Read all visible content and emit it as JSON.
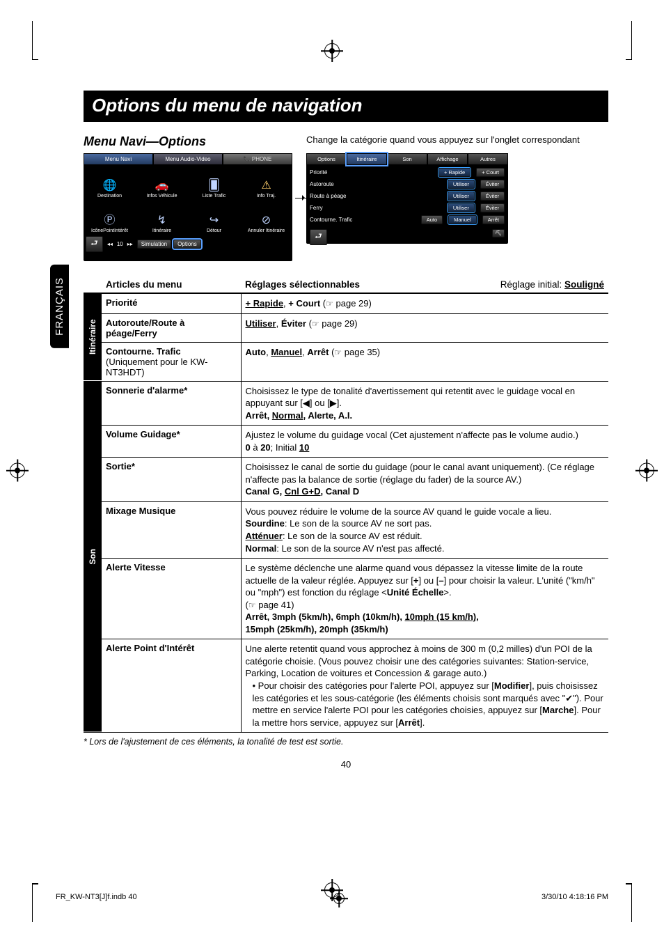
{
  "language_tab": "FRANÇAIS",
  "title": "Options du menu de navigation",
  "section_title": "Menu Navi—Options",
  "section_note": "Change la catégorie quand vous appuyez sur l'onglet correspondant",
  "screen_left": {
    "tabs": {
      "navi": "Menu Navi",
      "av": "Menu Audio-Video",
      "phone": "PHONE"
    },
    "icons": {
      "destination": "Destination",
      "vehinfo": "Infos Véhicule",
      "traffic_list": "Liste Trafic",
      "traffic_info": "Info Traj.",
      "poi_icon": "IcônePointIntérêt",
      "route": "Itinéraire",
      "detour": "Détour",
      "cancel_route": "Annuler Itinéraire"
    },
    "bottom": {
      "pager": "10",
      "sim": "Simulation",
      "options": "Options"
    }
  },
  "screen_right": {
    "tabs": {
      "options": "Options",
      "route": "Itinéraire",
      "sound": "Son",
      "display": "Affichage",
      "others": "Autres"
    },
    "rows": {
      "priority": {
        "label": "Priorité",
        "a": "+ Rapide",
        "b": "+ Court"
      },
      "motorway": {
        "label": "Autoroute",
        "a": "Utiliser",
        "b": "Éviter"
      },
      "toll": {
        "label": "Route à péage",
        "a": "Utiliser",
        "b": "Éviter"
      },
      "ferry": {
        "label": "Ferry",
        "a": "Utiliser",
        "b": "Éviter"
      },
      "reroute": {
        "label": "Contourne. Trafic",
        "a": "Auto",
        "b": "Manuel",
        "c": "Arrêt"
      }
    }
  },
  "table": {
    "h_menu": "Articles du menu",
    "h_set": "Réglages sélectionnables",
    "h_init_prefix": "Réglage initial: ",
    "h_init_value": "Souligné",
    "cat_route": "Itinéraire",
    "cat_sound": "Son",
    "priority": {
      "label": "Priorité",
      "value_a": "+ Rapide",
      "value_b": "+ Court",
      "ref": "page 29"
    },
    "motorway": {
      "label": "Autoroute/Route à péage/Ferry",
      "value_a": "Utiliser",
      "value_b": "Éviter",
      "ref": "page 29"
    },
    "reroute": {
      "label_a": "Contourne. Trafic",
      "label_b": "(Uniquement pour le KW-NT3HDT)",
      "value_a": "Auto",
      "value_b": "Manuel",
      "value_c": "Arrêt",
      "ref": "page 35"
    },
    "beep": {
      "label": "Sonnerie d'alarme",
      "desc": "Choisissez le type de tonalité d'avertissement qui retentit avec le guidage vocal en appuyant sur [◀] ou [▶].",
      "vals": "Arrêt, Normal, Alerte, A.I."
    },
    "volume": {
      "label": "Volume Guidage",
      "desc": "Ajustez le volume du guidage vocal (Cet ajustement n'affecte pas le volume audio.)",
      "vals_a": "0",
      "vals_mid": " à ",
      "vals_b": "20",
      "vals_init": "; Initial ",
      "vals_c": "10"
    },
    "output": {
      "label": "Sortie",
      "desc": "Choisissez le canal de sortie du guidage (pour le canal avant uniquement). (Ce réglage n'affecte pas la balance de sortie (réglage du fader) de la source AV.)",
      "vals": "Canal G, Cnl G+D, Canal D"
    },
    "mix": {
      "label": "Mixage Musique",
      "desc": "Vous pouvez réduire le volume de la source AV quand le guide vocale a lieu.",
      "l_mute": "Sourdine",
      "d_mute": ": Le son de la source AV ne sort pas.",
      "l_att": "Atténuer",
      "d_att": ": Le son de la source AV est réduit.",
      "l_norm": "Normal",
      "d_norm": ": Le son de la source AV n'est pas affecté."
    },
    "speed": {
      "label": "Alerte Vitesse",
      "desc_a": "Le système déclenche une alarme quand vous dépassez la vitesse limite de la route actuelle de la valeur réglée. Appuyez sur [",
      "plus": "+",
      "desc_b": "] ou [",
      "minus": "–",
      "desc_c": "] pour choisir la valeur. L'unité (\"km/h\" ou \"mph\") est fonction du réglage <",
      "unit": "Unité Échelle",
      "desc_d": ">.",
      "ref": "page 41",
      "v1": "Arrêt",
      "v2": "3mph (5km/h)",
      "v3": "6mph (10km/h)",
      "v4": "10mph (15 km/h)",
      "v5": "15mph (25km/h)",
      "v6": "20mph (35km/h)"
    },
    "poi": {
      "label": "Alerte Point d'Intérêt",
      "desc": "Une alerte retentit quand vous approchez à moins de 300 m (0,2 milles) d'un POI de la catégorie choisie. (Vous pouvez choisir une des catégories suivantes: Station-service, Parking, Location de voitures et Concession & garage auto.)",
      "bul_a": "Pour choisir des catégories pour l'alerte POI, appuyez sur [",
      "mod": "Modifier",
      "bul_b": "], puis choisissez les catégories et les sous-catégorie (les éléments choisis sont marqués avec \"✔\"). Pour mettre en service l'alerte POI pour les catégories choisies, appuyez sur [",
      "on": "Marche",
      "bul_c": "]. Pour la mettre hors service, appuyez sur [",
      "off": "Arrêt",
      "bul_d": "]."
    }
  },
  "asterisk_note": "*  Lors de l'ajustement de ces éléments, la tonalité de test est sortie.",
  "page_number": "40",
  "footer": {
    "left": "FR_KW-NT3[J]f.indb   40",
    "right": "3/30/10   4:18:16 PM"
  }
}
